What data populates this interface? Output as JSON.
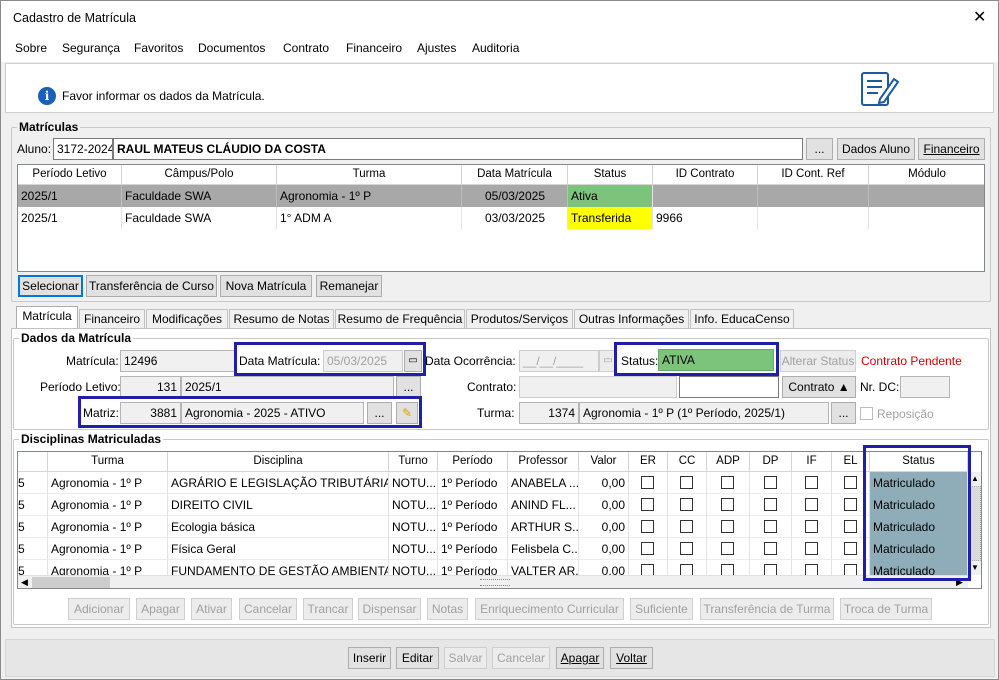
{
  "window": {
    "title": "Cadastro de Matrícula",
    "close": "✕"
  },
  "menu": [
    "Sobre",
    "Segurança",
    "Favoritos",
    "Documentos",
    "Contrato",
    "Financeiro",
    "Ajustes",
    "Auditoria"
  ],
  "info_message": "Favor informar os dados da Matrícula.",
  "matriculas": {
    "group_title": "Matrículas",
    "aluno_label": "Aluno:",
    "aluno_code": "3172-2024",
    "aluno_name": "RAUL MATEUS CLÁUDIO DA COSTA",
    "ellipsis": "...",
    "dados_aluno": "Dados Aluno",
    "financeiro": "Financeiro",
    "columns": [
      "Período Letivo",
      "Câmpus/Polo",
      "Turma",
      "Data Matrícula",
      "Status",
      "ID Contrato",
      "ID Cont. Ref",
      "Módulo"
    ],
    "rows": [
      {
        "periodo": "2025/1",
        "campus": "Faculdade SWA",
        "turma": "Agronomia - 1º P",
        "data": "05/03/2025",
        "status": "Ativa",
        "id_contrato": "",
        "id_ref": "",
        "modulo": ""
      },
      {
        "periodo": "2025/1",
        "campus": "Faculdade SWA",
        "turma": "1° ADM A",
        "data": "03/03/2025",
        "status": "Transferida",
        "id_contrato": "9966",
        "id_ref": "",
        "modulo": ""
      }
    ],
    "buttons": [
      "Selecionar",
      "Transferência de Curso",
      "Nova Matrícula",
      "Remanejar"
    ]
  },
  "tabs": [
    "Matrícula",
    "Financeiro",
    "Modificações",
    "Resumo de Notas",
    "Resumo de Frequência",
    "Produtos/Serviços",
    "Outras Informações",
    "Info. EducaCenso"
  ],
  "dados": {
    "group_title": "Dados da Matrícula",
    "matricula_label": "Matrícula:",
    "matricula": "12496",
    "data_matricula_label": "Data Matrícula:",
    "data_matricula": "05/03/2025",
    "data_ocorrencia_label": "Data Ocorrência:",
    "data_ocorrencia": "__/__/____",
    "status_label": "Status:",
    "status": "ATIVA",
    "alterar_status": "Alterar Status",
    "contrato_pendente": "Contrato Pendente",
    "periodo_label": "Período Letivo:",
    "periodo_code": "131",
    "periodo": "2025/1",
    "contrato_label": "Contrato:",
    "contrato_btn": "Contrato ▲",
    "nr_dc_label": "Nr. DC:",
    "matriz_label": "Matriz:",
    "matriz_code": "3881",
    "matriz": "Agronomia - 2025 - ATIVO",
    "turma_label": "Turma:",
    "turma_code": "1374",
    "turma": "Agronomia - 1º P (1º Período, 2025/1)",
    "reposicao": "Reposição"
  },
  "disciplinas": {
    "group_title": "Disciplinas Matriculadas",
    "columns": [
      "Turma",
      "Disciplina",
      "Turno",
      "Período",
      "Professor",
      "Valor",
      "ER",
      "CC",
      "ADP",
      "DP",
      "IF",
      "EL",
      "Status"
    ],
    "rows": [
      {
        "lead": "5",
        "turma": "Agronomia - 1º P",
        "disciplina": "AGRÁRIO E LEGISLAÇÃO TRIBUTÁRIA",
        "turno": "NOTU...",
        "periodo": "1º Período",
        "professor": "ANABELA ...",
        "valor": "0,00",
        "status": "Matriculado"
      },
      {
        "lead": "5",
        "turma": "Agronomia - 1º P",
        "disciplina": "DIREITO CIVIL",
        "turno": "NOTU...",
        "periodo": "1º Período",
        "professor": "ANIND FL...",
        "valor": "0,00",
        "status": "Matriculado"
      },
      {
        "lead": "5",
        "turma": "Agronomia - 1º P",
        "disciplina": "Ecologia básica",
        "turno": "NOTU...",
        "periodo": "1º Período",
        "professor": "ARTHUR S...",
        "valor": "0,00",
        "status": "Matriculado"
      },
      {
        "lead": "5",
        "turma": "Agronomia - 1º P",
        "disciplina": "Física Geral",
        "turno": "NOTU...",
        "periodo": "1º Período",
        "professor": "Felisbela C...",
        "valor": "0,00",
        "status": "Matriculado"
      },
      {
        "lead": "5",
        "turma": "Agronomia - 1º P",
        "disciplina": "FUNDAMENTO DE GESTÃO AMBIENTAL",
        "turno": "NOTU...",
        "periodo": "1º Período",
        "professor": "VALTER AR...",
        "valor": "0,00",
        "status": "Matriculado"
      }
    ],
    "buttons": [
      "Adicionar",
      "Apagar",
      "Ativar",
      "Cancelar",
      "Trancar",
      "Dispensar",
      "Notas",
      "Enriquecimento Curricular",
      "Suficiente",
      "Transferência de Turma",
      "Troca de Turma"
    ]
  },
  "footer_buttons": [
    "Inserir",
    "Editar",
    "Salvar",
    "Cancelar",
    "Apagar",
    "Voltar"
  ],
  "colors": {
    "ativa": "#7cc47c",
    "transferida": "#ffff00",
    "status_cell": "#8fadb8",
    "highlight": "#1f1fa8",
    "pendente": "#d40000"
  }
}
